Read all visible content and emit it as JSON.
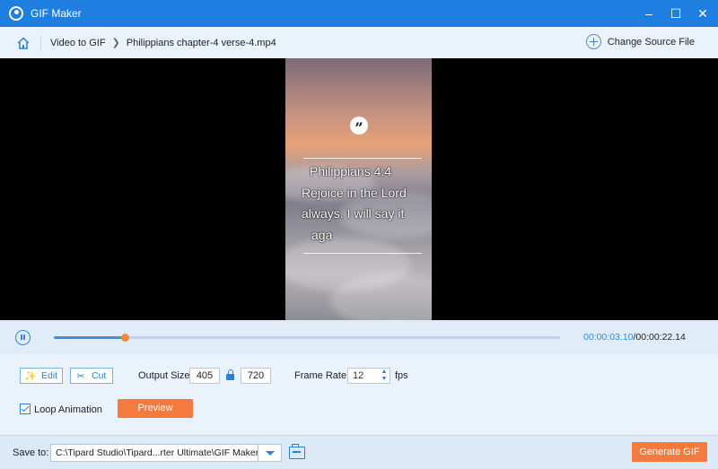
{
  "window": {
    "title": "GIF Maker",
    "controls": [
      "–",
      "☐",
      "✕"
    ]
  },
  "breadcrumb": {
    "items": [
      "Video to GIF",
      "Philippians chapter-4 verse-4.mp4"
    ],
    "change_source_label": "Change Source File"
  },
  "video_frame": {
    "text_lines": [
      "Philippians 4:4",
      "Rejoice in the Lord",
      "always. I will say it",
      "aga"
    ]
  },
  "playback": {
    "current_time": "00:00:03.10",
    "total_time": "00:00:22.14",
    "progress_fraction": 0.14
  },
  "tools": {
    "edit_label": "Edit",
    "cut_label": "Cut"
  },
  "output": {
    "size_label": "Output Size:",
    "width": "405",
    "height": "720",
    "frame_rate_label": "Frame Rate:",
    "frame_rate": "12",
    "fps_label": "fps"
  },
  "options": {
    "loop_label": "Loop Animation",
    "loop_checked": true,
    "preview_label": "Preview"
  },
  "footer": {
    "save_to_label": "Save to:",
    "save_path": "C:\\Tipard Studio\\Tipard...rter Ultimate\\GIF Maker",
    "generate_label": "Generate GIF"
  },
  "colors": {
    "titlebar": "#1e7fe0",
    "accent": "#2d7fd6",
    "action": "#f47a3d"
  }
}
